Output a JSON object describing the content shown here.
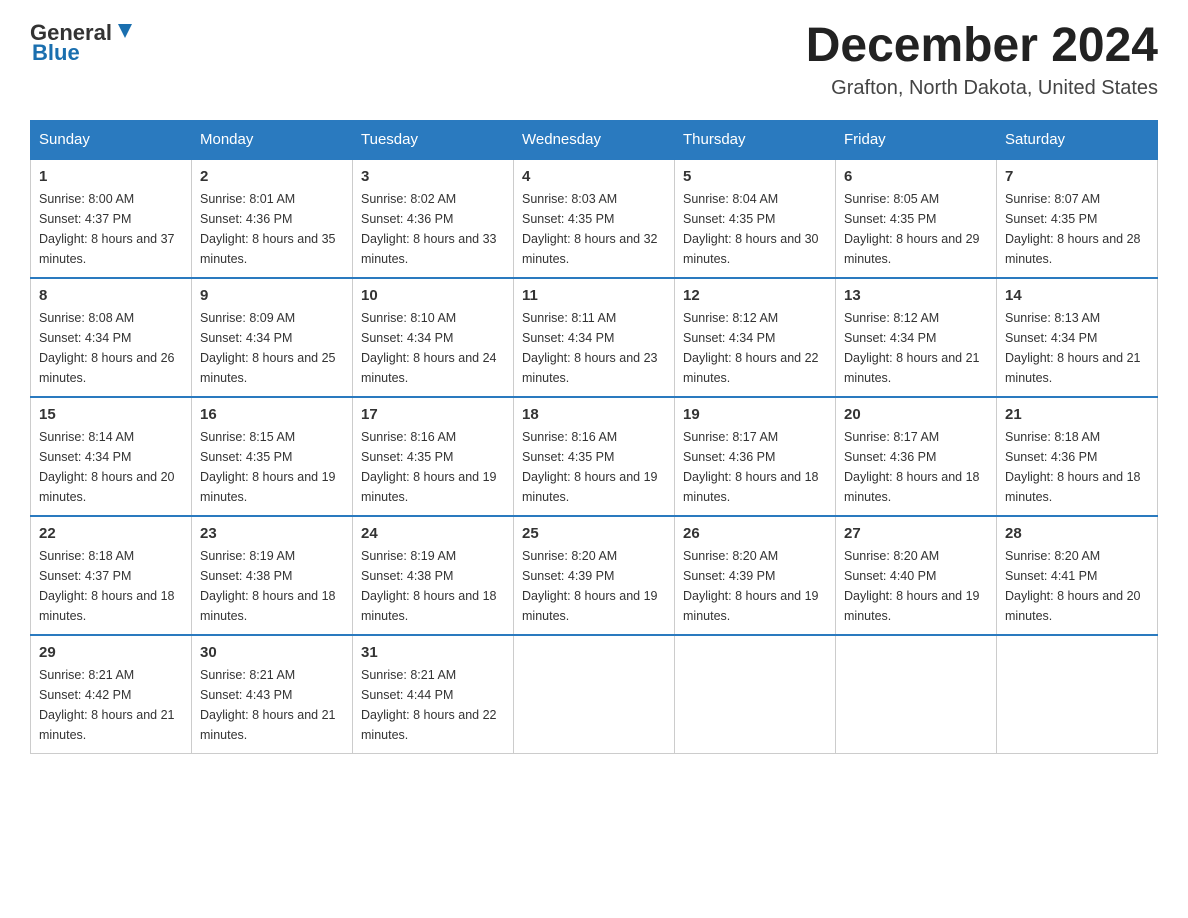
{
  "logo": {
    "text_general": "General",
    "text_blue": "Blue",
    "arrow_color": "#1a6faf"
  },
  "header": {
    "month_title": "December 2024",
    "location": "Grafton, North Dakota, United States"
  },
  "weekdays": [
    "Sunday",
    "Monday",
    "Tuesday",
    "Wednesday",
    "Thursday",
    "Friday",
    "Saturday"
  ],
  "weeks": [
    [
      {
        "day": "1",
        "sunrise": "8:00 AM",
        "sunset": "4:37 PM",
        "daylight": "8 hours and 37 minutes."
      },
      {
        "day": "2",
        "sunrise": "8:01 AM",
        "sunset": "4:36 PM",
        "daylight": "8 hours and 35 minutes."
      },
      {
        "day": "3",
        "sunrise": "8:02 AM",
        "sunset": "4:36 PM",
        "daylight": "8 hours and 33 minutes."
      },
      {
        "day": "4",
        "sunrise": "8:03 AM",
        "sunset": "4:35 PM",
        "daylight": "8 hours and 32 minutes."
      },
      {
        "day": "5",
        "sunrise": "8:04 AM",
        "sunset": "4:35 PM",
        "daylight": "8 hours and 30 minutes."
      },
      {
        "day": "6",
        "sunrise": "8:05 AM",
        "sunset": "4:35 PM",
        "daylight": "8 hours and 29 minutes."
      },
      {
        "day": "7",
        "sunrise": "8:07 AM",
        "sunset": "4:35 PM",
        "daylight": "8 hours and 28 minutes."
      }
    ],
    [
      {
        "day": "8",
        "sunrise": "8:08 AM",
        "sunset": "4:34 PM",
        "daylight": "8 hours and 26 minutes."
      },
      {
        "day": "9",
        "sunrise": "8:09 AM",
        "sunset": "4:34 PM",
        "daylight": "8 hours and 25 minutes."
      },
      {
        "day": "10",
        "sunrise": "8:10 AM",
        "sunset": "4:34 PM",
        "daylight": "8 hours and 24 minutes."
      },
      {
        "day": "11",
        "sunrise": "8:11 AM",
        "sunset": "4:34 PM",
        "daylight": "8 hours and 23 minutes."
      },
      {
        "day": "12",
        "sunrise": "8:12 AM",
        "sunset": "4:34 PM",
        "daylight": "8 hours and 22 minutes."
      },
      {
        "day": "13",
        "sunrise": "8:12 AM",
        "sunset": "4:34 PM",
        "daylight": "8 hours and 21 minutes."
      },
      {
        "day": "14",
        "sunrise": "8:13 AM",
        "sunset": "4:34 PM",
        "daylight": "8 hours and 21 minutes."
      }
    ],
    [
      {
        "day": "15",
        "sunrise": "8:14 AM",
        "sunset": "4:34 PM",
        "daylight": "8 hours and 20 minutes."
      },
      {
        "day": "16",
        "sunrise": "8:15 AM",
        "sunset": "4:35 PM",
        "daylight": "8 hours and 19 minutes."
      },
      {
        "day": "17",
        "sunrise": "8:16 AM",
        "sunset": "4:35 PM",
        "daylight": "8 hours and 19 minutes."
      },
      {
        "day": "18",
        "sunrise": "8:16 AM",
        "sunset": "4:35 PM",
        "daylight": "8 hours and 19 minutes."
      },
      {
        "day": "19",
        "sunrise": "8:17 AM",
        "sunset": "4:36 PM",
        "daylight": "8 hours and 18 minutes."
      },
      {
        "day": "20",
        "sunrise": "8:17 AM",
        "sunset": "4:36 PM",
        "daylight": "8 hours and 18 minutes."
      },
      {
        "day": "21",
        "sunrise": "8:18 AM",
        "sunset": "4:36 PM",
        "daylight": "8 hours and 18 minutes."
      }
    ],
    [
      {
        "day": "22",
        "sunrise": "8:18 AM",
        "sunset": "4:37 PM",
        "daylight": "8 hours and 18 minutes."
      },
      {
        "day": "23",
        "sunrise": "8:19 AM",
        "sunset": "4:38 PM",
        "daylight": "8 hours and 18 minutes."
      },
      {
        "day": "24",
        "sunrise": "8:19 AM",
        "sunset": "4:38 PM",
        "daylight": "8 hours and 18 minutes."
      },
      {
        "day": "25",
        "sunrise": "8:20 AM",
        "sunset": "4:39 PM",
        "daylight": "8 hours and 19 minutes."
      },
      {
        "day": "26",
        "sunrise": "8:20 AM",
        "sunset": "4:39 PM",
        "daylight": "8 hours and 19 minutes."
      },
      {
        "day": "27",
        "sunrise": "8:20 AM",
        "sunset": "4:40 PM",
        "daylight": "8 hours and 19 minutes."
      },
      {
        "day": "28",
        "sunrise": "8:20 AM",
        "sunset": "4:41 PM",
        "daylight": "8 hours and 20 minutes."
      }
    ],
    [
      {
        "day": "29",
        "sunrise": "8:21 AM",
        "sunset": "4:42 PM",
        "daylight": "8 hours and 21 minutes."
      },
      {
        "day": "30",
        "sunrise": "8:21 AM",
        "sunset": "4:43 PM",
        "daylight": "8 hours and 21 minutes."
      },
      {
        "day": "31",
        "sunrise": "8:21 AM",
        "sunset": "4:44 PM",
        "daylight": "8 hours and 22 minutes."
      },
      null,
      null,
      null,
      null
    ]
  ]
}
